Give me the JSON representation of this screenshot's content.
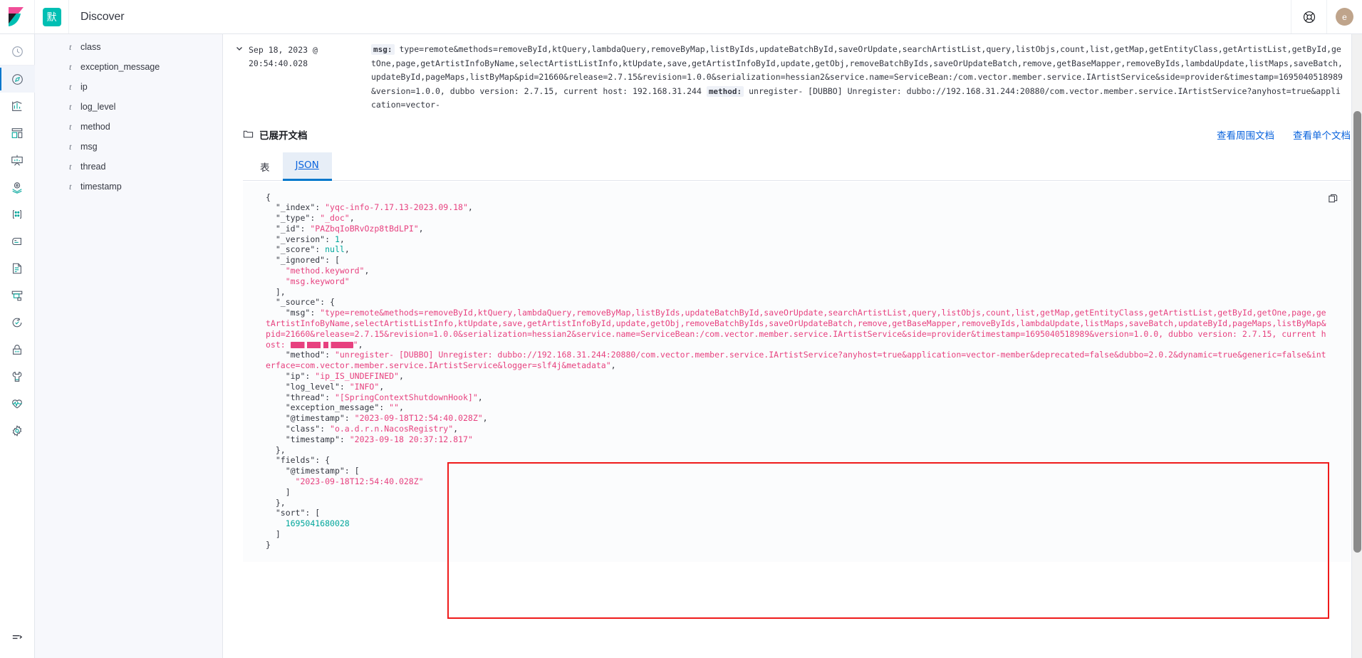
{
  "header": {
    "app_title": "Discover",
    "space_badge": "默",
    "logo_name": "kibana-logo",
    "help_icon": "lifebuoy-icon",
    "avatar_initial": "e"
  },
  "rail": {
    "items": [
      {
        "name": "recently-viewed",
        "icon": "clock-icon",
        "active": false
      },
      {
        "name": "discover",
        "icon": "compass-icon",
        "active": true
      },
      {
        "name": "visualize",
        "icon": "bar-chart-icon",
        "active": false
      },
      {
        "name": "dashboard",
        "icon": "dashboard-icon",
        "active": false
      },
      {
        "name": "canvas",
        "icon": "presentation-icon",
        "active": false
      },
      {
        "name": "maps",
        "icon": "map-marker-icon",
        "active": false
      },
      {
        "name": "machine-learning",
        "icon": "nodes-icon",
        "active": false
      },
      {
        "name": "graph",
        "icon": "graph-icon",
        "active": false
      },
      {
        "name": "logs",
        "icon": "document-icon",
        "active": false
      },
      {
        "name": "metrics",
        "icon": "monitor-icon",
        "active": false
      },
      {
        "name": "uptime",
        "icon": "uptime-icon",
        "active": false
      },
      {
        "name": "security",
        "icon": "lock-icon",
        "active": false
      },
      {
        "name": "dev-tools",
        "icon": "wrench-icon",
        "active": false
      },
      {
        "name": "stack-monitoring",
        "icon": "heartbeat-icon",
        "active": false
      },
      {
        "name": "stack-management",
        "icon": "gear-icon",
        "active": false
      }
    ],
    "collapse_icon": "collapse-panel-icon"
  },
  "fields": {
    "items": [
      {
        "type": "t",
        "name": "class"
      },
      {
        "type": "t",
        "name": "exception_message"
      },
      {
        "type": "t",
        "name": "ip"
      },
      {
        "type": "t",
        "name": "log_level"
      },
      {
        "type": "t",
        "name": "method"
      },
      {
        "type": "t",
        "name": "msg"
      },
      {
        "type": "t",
        "name": "thread"
      },
      {
        "type": "t",
        "name": "timestamp"
      }
    ]
  },
  "doc_row": {
    "timestamp": "Sep 18, 2023 @ 20:54:40.028",
    "msg_label": "msg:",
    "msg_value": "type=remote&methods=removeById,ktQuery,lambdaQuery,removeByMap,listByIds,updateBatchById,saveOrUpdate,searchArtistList,query,listObjs,count,list,getMap,getEntityClass,getArtistList,getById,getOne,page,getArtistInfoByName,selectArtistListInfo,ktUpdate,save,getArtistInfoById,update,getObj,removeBatchByIds,saveOrUpdateBatch,remove,getBaseMapper,removeByIds,lambdaUpdate,listMaps,saveBatch,updateById,pageMaps,listByMap&pid=21660&release=2.7.15&revision=1.0.0&serialization=hessian2&service.name=ServiceBean:/com.vector.member.service.IArtistService&side=provider&timestamp=1695040518989&version=1.0.0, dubbo version: 2.7.15, current host: 192.168.31.244 ",
    "method_label": "method:",
    "method_value": " unregister- [DUBBO] Unregister: dubbo://192.168.31.244:20880/com.vector.member.service.IArtistService?anyhost=true&application=vector-"
  },
  "expanded": {
    "title": "已展开文档",
    "folder_icon": "folder-icon",
    "link_surrounding": "查看周围文档",
    "link_single": "查看单个文档",
    "tabs": [
      {
        "label": "表",
        "active": false
      },
      {
        "label": "JSON",
        "active": true
      }
    ],
    "copy_icon": "copy-icon"
  },
  "json_doc": {
    "_index": "yqc-info-7.17.13-2023.09.18",
    "_type": "_doc",
    "_id": "PAZbqIoBRvOzp8tBdLPI",
    "_version": 1,
    "_score": null,
    "_ignored": [
      "method.keyword",
      "msg.keyword"
    ],
    "_source": {
      "msg": "type=remote&methods=removeById,ktQuery,lambdaQuery,removeByMap,listByIds,updateBatchById,saveOrUpdate,searchArtistList,query,listObjs,count,list,getMap,getEntityClass,getArtistList,getById,getOne,page,getArtistInfoByName,selectArtistListInfo,ktUpdate,save,getArtistInfoById,update,getObj,removeBatchByIds,saveOrUpdateBatch,remove,getBaseMapper,removeByIds,lambdaUpdate,listMaps,saveBatch,updateById,pageMaps,listByMap&pid=21660&release=2.7.15&revision=1.0.0&serialization=hessian2&service.name=ServiceBean:/com.vector.member.service.IArtistService&side=provider&timestamp=1695040518989&version=1.0.0, dubbo version: 2.7.15, current host: ",
      "msg_host_redacted": true,
      "method": "unregister- [DUBBO] Unregister: dubbo://192.168.31.244:20880/com.vector.member.service.IArtistService?anyhost=true&application=vector-member&deprecated=false&dubbo=2.0.2&dynamic=true&generic=false&interface=com.vector.member.service.IArtistService&logger=slf4j&metadata",
      "ip": "ip_IS_UNDEFINED",
      "log_level": "INFO",
      "thread": "[SpringContextShutdownHook]",
      "exception_message": "",
      "@timestamp": "2023-09-18T12:54:40.028Z",
      "class": "o.a.d.r.n.NacosRegistry",
      "timestamp": "2023-09-18 20:37:12.817"
    },
    "fields": {
      "@timestamp": [
        "2023-09-18T12:54:40.028Z"
      ]
    },
    "sort": [
      1695041680028
    ]
  },
  "colors": {
    "accent": "#0b64dd",
    "brand_teal": "#00bfb3",
    "json_string": "#e7417f",
    "json_number": "#00a69b",
    "highlight_box": "#ef1b1b"
  }
}
